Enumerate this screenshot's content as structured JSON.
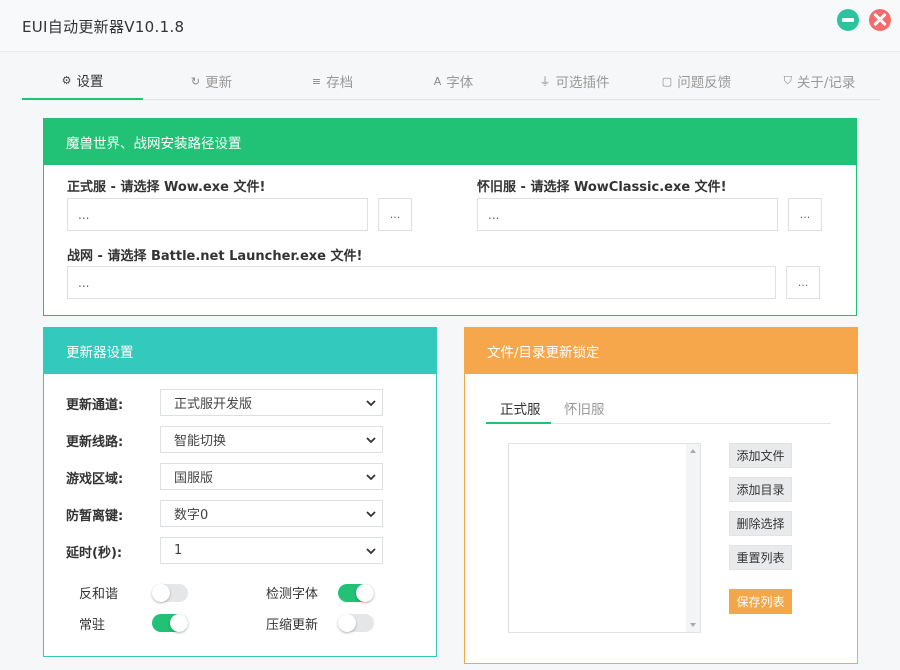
{
  "window": {
    "title": "EUI自动更新器V10.1.8"
  },
  "tabs": [
    {
      "label": "设置",
      "icon": "gear-icon"
    },
    {
      "label": "更新",
      "icon": "refresh-icon"
    },
    {
      "label": "存档",
      "icon": "database-icon"
    },
    {
      "label": "字体",
      "icon": "font-icon"
    },
    {
      "label": "可选插件",
      "icon": "plug-icon"
    },
    {
      "label": "问题反馈",
      "icon": "comment-icon"
    },
    {
      "label": "关于/记录",
      "icon": "shield-icon"
    }
  ],
  "install": {
    "title": "魔兽世界、战网安装路径设置",
    "retail_label": "正式服 - 请选择 Wow.exe 文件!",
    "classic_label": "怀旧服 - 请选择 WowClassic.exe 文件!",
    "bnet_label": "战网 - 请选择 Battle.net Launcher.exe 文件!",
    "retail_value": "...",
    "classic_value": "...",
    "bnet_value": "...",
    "browse_label": "..."
  },
  "updater": {
    "title": "更新器设置",
    "channel_label": "更新通道:",
    "channel_value": "正式服开发版",
    "route_label": "更新线路:",
    "route_value": "智能切换",
    "region_label": "游戏区域:",
    "region_value": "国服版",
    "afk_label": "防暂离键:",
    "afk_value": "数字0",
    "delay_label": "延时(秒):",
    "delay_value": "1",
    "toggles": {
      "harmony_label": "反和谐",
      "resident_label": "常驻",
      "detect_font_label": "检测字体",
      "compress_label": "压缩更新"
    }
  },
  "lock": {
    "title": "文件/目录更新锁定",
    "tab_retail": "正式服",
    "tab_classic": "怀旧服",
    "add_file": "添加文件",
    "add_dir": "添加目录",
    "delete_sel": "删除选择",
    "reset_list": "重置列表",
    "save_list": "保存列表"
  },
  "colors": {
    "green": "#21c276",
    "teal": "#34c9bd",
    "orange": "#f7a74b"
  }
}
